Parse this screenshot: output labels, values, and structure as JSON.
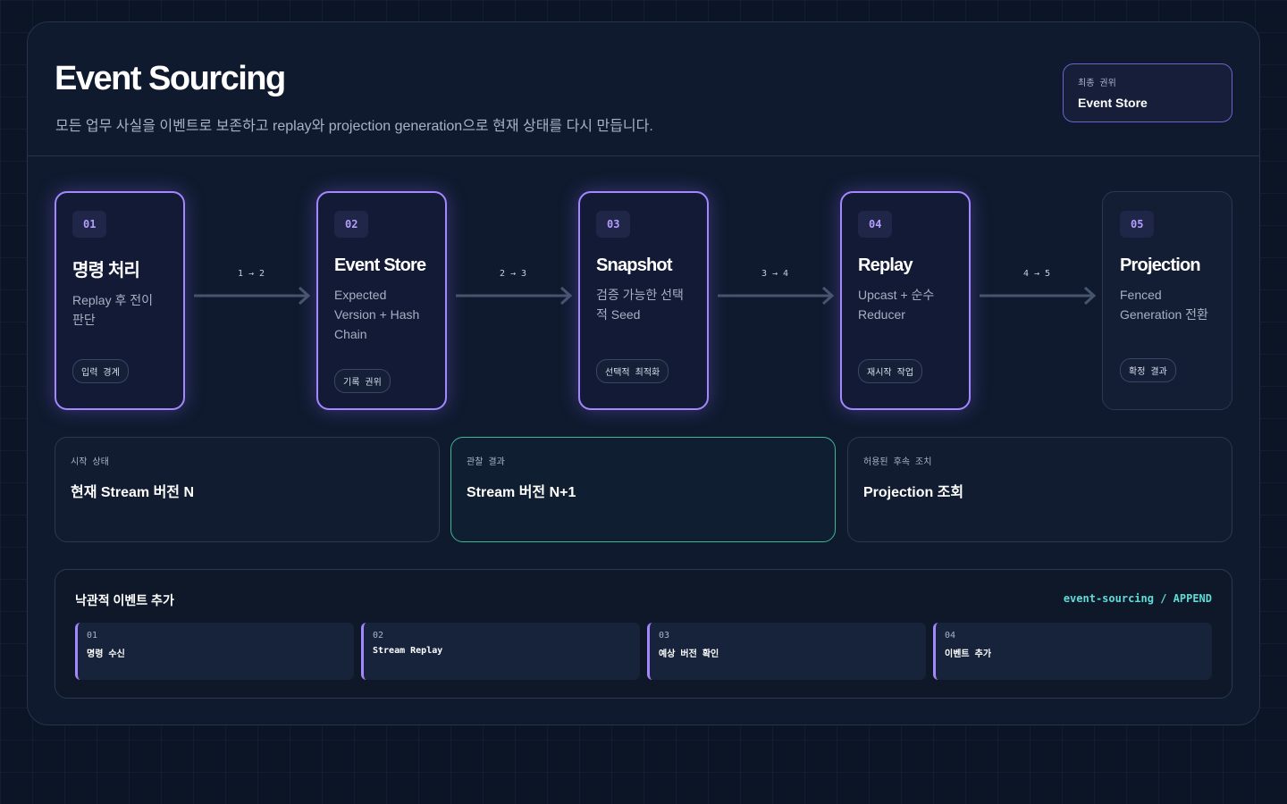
{
  "header": {
    "title": "Event Sourcing",
    "subtitle": "모든 업무 사실을 이벤트로 보존하고 replay와 projection generation으로 현재 상태를 다시 만듭니다.",
    "authority_label": "최종 권위",
    "authority_value": "Event Store"
  },
  "steps": [
    {
      "num": "01",
      "name": "명령 처리",
      "desc": "Replay 후 전이 판단",
      "tag": "입력 경계"
    },
    {
      "num": "02",
      "name": "Event Store",
      "desc": "Expected Version + Hash Chain",
      "tag": "기록 권위"
    },
    {
      "num": "03",
      "name": "Snapshot",
      "desc": "검증 가능한 선택적 Seed",
      "tag": "선택적 최적화"
    },
    {
      "num": "04",
      "name": "Replay",
      "desc": "Upcast + 순수 Reducer",
      "tag": "재시작 작업"
    },
    {
      "num": "05",
      "name": "Projection",
      "desc": "Fenced Generation 전환",
      "tag": "확정 결과"
    }
  ],
  "connectors": [
    "1 → 2",
    "2 → 3",
    "3 → 4",
    "4 → 5"
  ],
  "states": [
    {
      "label": "시작 상태",
      "value": "현재 Stream 버전 N"
    },
    {
      "label": "관찰 결과",
      "value": "Stream 버전 N+1"
    },
    {
      "label": "허용된 후속 조치",
      "value": "Projection 조회"
    }
  ],
  "append": {
    "title": "낙관적 이벤트 추가",
    "right": "event-sourcing / APPEND",
    "steps": [
      {
        "num": "01",
        "label": "명령 수신"
      },
      {
        "num": "02",
        "label": "Stream Replay"
      },
      {
        "num": "03",
        "label": "예상 버전 확인"
      },
      {
        "num": "04",
        "label": "이벤트 추가"
      }
    ]
  },
  "colors": {
    "accent": "#a486ff",
    "highlight": "#3fb897",
    "code": "#5fdcd8"
  }
}
